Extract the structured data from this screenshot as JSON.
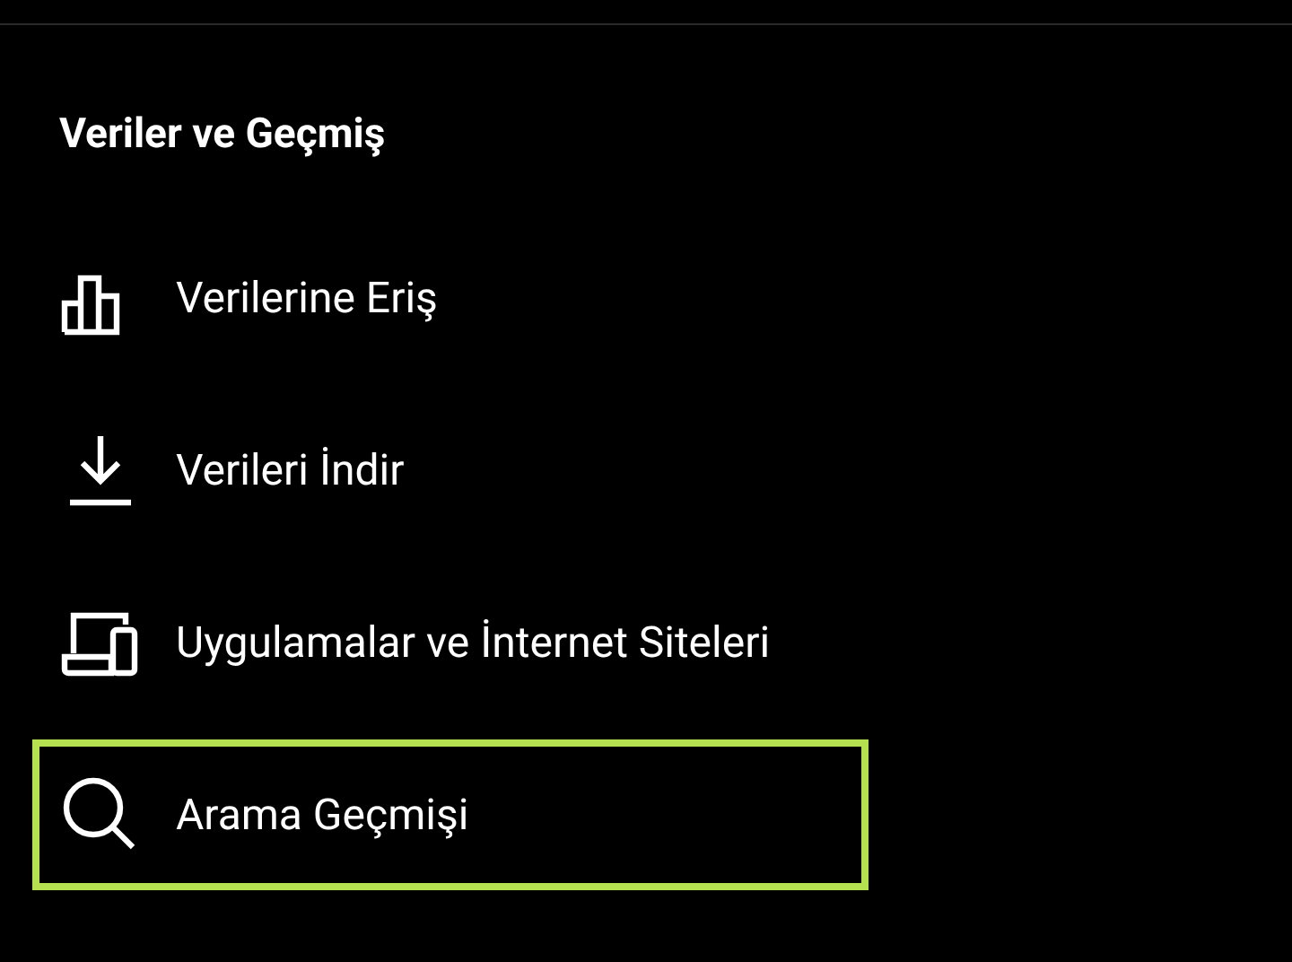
{
  "section": {
    "title": "Veriler ve Geçmiş"
  },
  "items": [
    {
      "kind": "chart",
      "label": "Verilerine Eriş",
      "selected": false
    },
    {
      "kind": "download",
      "label": "Verileri İndir",
      "selected": false
    },
    {
      "kind": "devices",
      "label": "Uygulamalar ve İnternet Siteleri",
      "selected": false
    },
    {
      "kind": "search",
      "label": "Arama Geçmişi",
      "selected": true
    }
  ]
}
